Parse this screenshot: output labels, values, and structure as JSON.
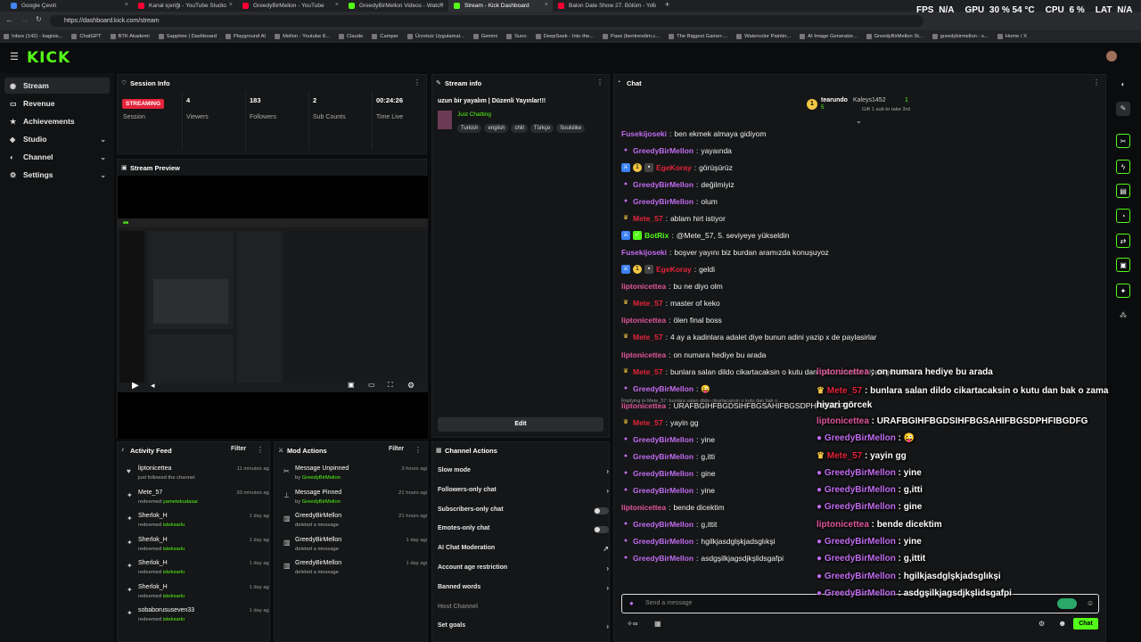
{
  "browser": {
    "tabs": [
      {
        "title": "Google Çeviri",
        "color": "#4285f4"
      },
      {
        "title": "Kanal içeriği - YouTube Studio",
        "color": "#ff0033"
      },
      {
        "title": "GreedyBirMellon - YouTube",
        "color": "#ff0033"
      },
      {
        "title": "GreedyBirMellon Videos - Watch",
        "color": "#53fc18"
      },
      {
        "title": "Stream - Kick Dashboard",
        "color": "#53fc18"
      },
      {
        "title": "Balon Date Show 27. Bölüm - You",
        "color": "#ff0033"
      }
    ],
    "new_tab": "+",
    "url": "https://dashboard.kick.com/stream",
    "bookmarks": [
      "Inbox (142) - bagisis...",
      "ChatGPT",
      "BTK Akademi",
      "Sapphire | Dashboard",
      "Playground AI",
      "Mellon - Youtube 8...",
      "Claude",
      "Camper",
      "Ücretsiz Uygulamal...",
      "Gemini",
      "Suno",
      "DeepSeek - Into the...",
      "Paso (bentrendim.c...",
      "The Biggest Gamer-...",
      "Watercolor Paintin...",
      "AI Image Generator...",
      "GreedyBirMellon St...",
      "greedybirmellon - s...",
      "Home / X"
    ]
  },
  "hud": {
    "fps_label": "FPS",
    "fps_value": "N/A",
    "gpu_label": "GPU",
    "gpu_value": "30 % 54 °C",
    "cpu_label": "CPU",
    "cpu_value": "6 %",
    "lat_label": "LAT",
    "lat_value": "N/A"
  },
  "logo": "KICK",
  "sidebar": [
    {
      "label": "Stream",
      "icon": "broadcast-icon",
      "glyph": "◉",
      "active": true,
      "chev": ""
    },
    {
      "label": "Revenue",
      "icon": "money-icon",
      "glyph": "▭",
      "active": false,
      "chev": ""
    },
    {
      "label": "Achievements",
      "icon": "trophy-icon",
      "glyph": "★",
      "active": false,
      "chev": ""
    },
    {
      "label": "Studio",
      "icon": "studio-icon",
      "glyph": "◈",
      "active": false,
      "chev": "⌄"
    },
    {
      "label": "Channel",
      "icon": "channel-icon",
      "glyph": "◐",
      "active": false,
      "chev": "⌄"
    },
    {
      "label": "Settings",
      "icon": "gear-icon",
      "glyph": "⚙",
      "active": false,
      "chev": "⌄"
    }
  ],
  "session": {
    "title": "Session Info",
    "status_badge": "STREAMING",
    "stats": [
      {
        "value": "",
        "label": "Session"
      },
      {
        "value": "4",
        "label": "Viewers"
      },
      {
        "value": "183",
        "label": "Followers"
      },
      {
        "value": "2",
        "label": "Sub Counts"
      },
      {
        "value": "00:24:26",
        "label": "Time Live"
      }
    ]
  },
  "preview": {
    "title": "Stream Preview"
  },
  "stream_info": {
    "title": "Stream info",
    "stream_title": "uzun bir yayalım | Düzenli Yayınlar!!!",
    "category": "Just Chatting",
    "tags": [
      "Turkish",
      "english",
      "chill",
      "Türkçe",
      "Soulslike"
    ],
    "edit_label": "Edit"
  },
  "activity": {
    "title": "Activity Feed",
    "filter": "Filter",
    "items": [
      {
        "name": "liptonicettea",
        "sub": "just followed the channel",
        "reward": "",
        "time": "11 minutes ago",
        "icon": "heart-icon",
        "glyph": "♥"
      },
      {
        "name": "Mete_57",
        "sub": "redeemed",
        "reward": "yametekudasai",
        "time": "30 minutes ago",
        "icon": "redeem-icon",
        "glyph": "✦"
      },
      {
        "name": "Sherlok_H",
        "sub": "redeemed",
        "reward": "isteksarkı",
        "time": "1 day ago",
        "icon": "redeem-icon",
        "glyph": "✦"
      },
      {
        "name": "Sherlok_H",
        "sub": "redeemed",
        "reward": "isteksarkı",
        "time": "1 day ago",
        "icon": "redeem-icon",
        "glyph": "✦"
      },
      {
        "name": "Sherlok_H",
        "sub": "redeemed",
        "reward": "isteksarkı",
        "time": "1 day ago",
        "icon": "redeem-icon",
        "glyph": "✦"
      },
      {
        "name": "Sherlok_H",
        "sub": "redeemed",
        "reward": "isteksarkı",
        "time": "1 day ago",
        "icon": "redeem-icon",
        "glyph": "✦"
      },
      {
        "name": "sobaborususeven33",
        "sub": "redeemed",
        "reward": "isteksarkı",
        "time": "1 day ago",
        "icon": "redeem-icon",
        "glyph": "✦"
      }
    ]
  },
  "mod": {
    "title": "Mod Actions",
    "filter": "Filter",
    "items": [
      {
        "name": "Message Unpinned",
        "sub": "by",
        "by": "GreedyBirMellon",
        "time": "3 hours ago",
        "icon": "unpin-icon",
        "glyph": "✂"
      },
      {
        "name": "Message Pinned",
        "sub": "by",
        "by": "GreedyBirMellon",
        "time": "21 hours ago",
        "icon": "pin-icon",
        "glyph": "⊥"
      },
      {
        "name": "GreedyBirMellon",
        "sub": "deleted a message",
        "by": "",
        "time": "21 hours ago",
        "icon": "trash-icon",
        "glyph": "▥"
      },
      {
        "name": "GreedyBirMellon",
        "sub": "deleted a message",
        "by": "",
        "time": "1 day ago",
        "icon": "trash-icon",
        "glyph": "▥"
      },
      {
        "name": "GreedyBirMellon",
        "sub": "deleted a message",
        "by": "",
        "time": "1 day ago",
        "icon": "trash-icon",
        "glyph": "▥"
      }
    ]
  },
  "channel_actions": {
    "title": "Channel Actions",
    "rows": [
      {
        "label": "Slow mode",
        "control": "›",
        "type": "chev"
      },
      {
        "label": "Followers-only chat",
        "control": "›",
        "type": "chev"
      },
      {
        "label": "Subscribers-only chat",
        "control": "",
        "type": "toggle"
      },
      {
        "label": "Emotes-only chat",
        "control": "",
        "type": "toggle"
      },
      {
        "label": "AI Chat Moderation",
        "control": "↗",
        "type": "chev"
      },
      {
        "label": "Account age restriction",
        "control": "›",
        "type": "chev"
      },
      {
        "label": "Banned words",
        "control": "›",
        "type": "chev"
      },
      {
        "label": "Host Channel",
        "control": "",
        "type": "muted"
      },
      {
        "label": "Set goals",
        "control": "›",
        "type": "chev"
      }
    ]
  },
  "chat": {
    "title": "Chat",
    "leader1": {
      "name": "tearundo",
      "count": "5"
    },
    "leader2": {
      "name": "Kaleys1452",
      "count": "1"
    },
    "gift_text": "Gift 1 sub to take 3rd",
    "reply_note": "Replying to Mete_57: bunlara salan dildo cikartacaksin o kutu dan bak o...",
    "input_placeholder": "Send a message",
    "send_label": "Chat",
    "messages": [
      {
        "user": "Fusekijoseki",
        "color": "#c06cf0",
        "badges": [],
        "text": "ben ekmek almaya gidiyom"
      },
      {
        "user": "GreedyBirMellon",
        "color": "#c06cf0",
        "badges": [
          "mic"
        ],
        "text": "yayaında"
      },
      {
        "user": "EgeKoray",
        "color": "#e5243b",
        "badges": [
          "mod",
          "sub",
          "gift"
        ],
        "text": "görüşürüz"
      },
      {
        "user": "GreedyBirMellon",
        "color": "#c06cf0",
        "badges": [
          "mic"
        ],
        "text": "değilmiyiz"
      },
      {
        "user": "GreedyBirMellon",
        "color": "#c06cf0",
        "badges": [
          "mic"
        ],
        "text": "olum"
      },
      {
        "user": "Mete_57",
        "color": "#e5243b",
        "badges": [
          "crown"
        ],
        "text": "ablam hirt istiyor"
      },
      {
        "user": "BotRix",
        "color": "#53fc18",
        "badges": [
          "mod",
          "bot"
        ],
        "text": "@Mete_57, 5. seviyeye yükseldin"
      },
      {
        "user": "Fusekijoseki",
        "color": "#c06cf0",
        "badges": [],
        "text": "boşver yayını biz burdan aramızda konuşuyoz"
      },
      {
        "user": "EgeKoray",
        "color": "#e5243b",
        "badges": [
          "mod",
          "sub",
          "gift"
        ],
        "text": "geldi"
      },
      {
        "user": "liptonicettea",
        "color": "#e0569b",
        "badges": [],
        "text": "bu ne diyo olm"
      },
      {
        "user": "Mete_57",
        "color": "#e5243b",
        "badges": [
          "crown"
        ],
        "text": "master of keko"
      },
      {
        "user": "liptonicettea",
        "color": "#e0569b",
        "badges": [],
        "text": "ölen final boss"
      },
      {
        "user": "Mete_57",
        "color": "#e5243b",
        "badges": [
          "crown"
        ],
        "text": "4 ay a kadinlara adalet diye bunun adini yazip x de paylasirlar"
      },
      {
        "user": "liptonicettea",
        "color": "#e0569b",
        "badges": [],
        "text": "on numara hediye bu arada"
      },
      {
        "user": "Mete_57",
        "color": "#e5243b",
        "badges": [
          "crown"
        ],
        "text": "bunlara salan dildo cikartacaksin o kutu dan bak o zaman hiyari görcek"
      },
      {
        "user": "GreedyBirMellon",
        "color": "#c06cf0",
        "badges": [
          "mic"
        ],
        "text": "😜"
      },
      {
        "user": "liptonicettea",
        "color": "#e0569b",
        "badges": [],
        "text": "URAFBGIHFBGDSIHFBGSAHIFBGSDPHFIBGDFG"
      },
      {
        "user": "Mete_57",
        "color": "#e5243b",
        "badges": [
          "crown"
        ],
        "text": "yayin gg"
      },
      {
        "user": "GreedyBirMellon",
        "color": "#c06cf0",
        "badges": [
          "mic"
        ],
        "text": "yine"
      },
      {
        "user": "GreedyBirMellon",
        "color": "#c06cf0",
        "badges": [
          "mic"
        ],
        "text": "g,itti"
      },
      {
        "user": "GreedyBirMellon",
        "color": "#c06cf0",
        "badges": [
          "mic"
        ],
        "text": "gine"
      },
      {
        "user": "GreedyBirMellon",
        "color": "#c06cf0",
        "badges": [
          "mic"
        ],
        "text": "yine"
      },
      {
        "user": "liptonicettea",
        "color": "#e0569b",
        "badges": [],
        "text": "bende dicektim"
      },
      {
        "user": "GreedyBirMellon",
        "color": "#c06cf0",
        "badges": [
          "mic"
        ],
        "text": "g,ittit"
      },
      {
        "user": "GreedyBirMellon",
        "color": "#c06cf0",
        "badges": [
          "mic"
        ],
        "text": "hgilkjasdglşkjadsglıkşi"
      },
      {
        "user": "GreedyBirMellon",
        "color": "#c06cf0",
        "badges": [
          "mic"
        ],
        "text": "asdgşilkjagsdjkşlidsgafpi"
      }
    ]
  },
  "overlay_chat": [
    {
      "user": "liptonicettea",
      "color": "#e0569b",
      "badge": "",
      "text": "on numara hediye bu arada"
    },
    {
      "user": "Mete_57",
      "color": "#e5243b",
      "badge": "crown",
      "text": "bunlara salan dildo cikartacaksin o kutu dan bak o zaman hiyari görcek"
    },
    {
      "user": "liptonicettea",
      "color": "#e0569b",
      "badge": "",
      "text": "URAFBGIHFBGDSIHFBGSAHIFBGSDPHFIBGDFG"
    },
    {
      "user": "GreedyBirMellon",
      "color": "#c06cf0",
      "badge": "mic",
      "text": "😜"
    },
    {
      "user": "Mete_57",
      "color": "#e5243b",
      "badge": "crown",
      "text": "yayin gg"
    },
    {
      "user": "GreedyBirMellon",
      "color": "#c06cf0",
      "badge": "mic",
      "text": "yine"
    },
    {
      "user": "GreedyBirMellon",
      "color": "#c06cf0",
      "badge": "mic",
      "text": "g,itti"
    },
    {
      "user": "GreedyBirMellon",
      "color": "#c06cf0",
      "badge": "mic",
      "text": "gine"
    },
    {
      "user": "liptonicettea",
      "color": "#e0569b",
      "badge": "",
      "text": "bende dicektim"
    },
    {
      "user": "GreedyBirMellon",
      "color": "#c06cf0",
      "badge": "mic",
      "text": "yine"
    },
    {
      "user": "GreedyBirMellon",
      "color": "#c06cf0",
      "badge": "mic",
      "text": "g,ittit"
    },
    {
      "user": "GreedyBirMellon",
      "color": "#c06cf0",
      "badge": "mic",
      "text": "hgilkjasdglşkjadsglıkşi"
    },
    {
      "user": "GreedyBirMellon",
      "color": "#c06cf0",
      "badge": "mic",
      "text": "asdgşilkjagsdjkşlidsgafpi"
    }
  ],
  "colors": {
    "brand": "#53fc18",
    "live": "#e5243b",
    "panel": "#151617"
  }
}
